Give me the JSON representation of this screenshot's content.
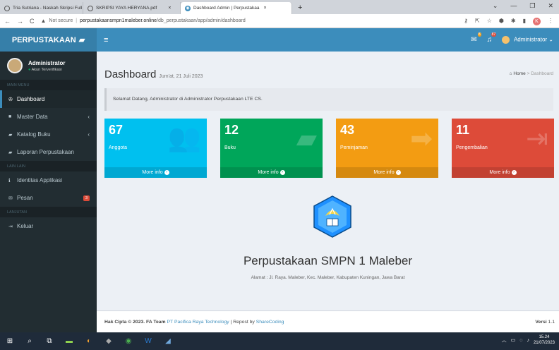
{
  "browser": {
    "tabs": [
      {
        "label": "Tria Sutriana - Naskah Skripsi Full"
      },
      {
        "label": "SKRIPSI YAYA HERYANA.pdf"
      },
      {
        "label": "Dashboard Admin | Perpustakaa"
      }
    ],
    "new_tab": "+",
    "url_security": "Not secure",
    "url_host": "perpustakaansmpn1maleber.online",
    "url_path": "/db_perpustakaan/app/admin/dashboard",
    "profile_initial": "K"
  },
  "header": {
    "logo": "PERPUSTAKAAN",
    "mail_count": "8",
    "notif_count": "87",
    "user": "Administrator"
  },
  "sidebar": {
    "user_name": "Administrator",
    "user_status": "Akun Terverifikasi",
    "sections": {
      "main": "MAIN MENU",
      "other": "LAIN LAIN",
      "next": "LANJUTAN"
    },
    "items": [
      {
        "label": "Dashboard"
      },
      {
        "label": "Master Data"
      },
      {
        "label": "Katalog Buku"
      },
      {
        "label": "Laporan Perpustakaan"
      },
      {
        "label": "Identitas Applikasi"
      },
      {
        "label": "Pesan",
        "badge": "3"
      },
      {
        "label": "Keluar"
      }
    ]
  },
  "content": {
    "title": "Dashboard",
    "subtitle": "Jum'at, 21 Juli 2023",
    "breadcrumb": {
      "home": "Home",
      "sep": ">",
      "current": "Dashboard"
    },
    "welcome": "Selamat Datang, Administrator di Administrator Perpustakaan LTE CS.",
    "boxes": [
      {
        "value": "67",
        "label": "Anggota",
        "more": "More info",
        "color": "#00c0ef"
      },
      {
        "value": "12",
        "label": "Buku",
        "more": "More info",
        "color": "#00a65a"
      },
      {
        "value": "43",
        "label": "Peminjaman",
        "more": "More info",
        "color": "#f39c12"
      },
      {
        "value": "11",
        "label": "Pengembalian",
        "more": "More info",
        "color": "#dd4b39"
      }
    ],
    "library_name": "Perpustakaan SMPN 1 Maleber",
    "address": "Alamat : Jl. Raya. Maleber, Kec. Maleber, Kabupaten Kuningan, Jawa Barat",
    "emblem_text": "TUT WURI HANDAYANI"
  },
  "footer": {
    "copy": "Hak Cipta © 2023. FA Team",
    "company": "PT Pacifica Raya Technology",
    "repost": " | Repost by ",
    "repost_link": "ShareCoding",
    "version_label": "Versi",
    "version": "1.1"
  },
  "taskbar": {
    "time": "15.24",
    "date": "21/07/2023"
  }
}
